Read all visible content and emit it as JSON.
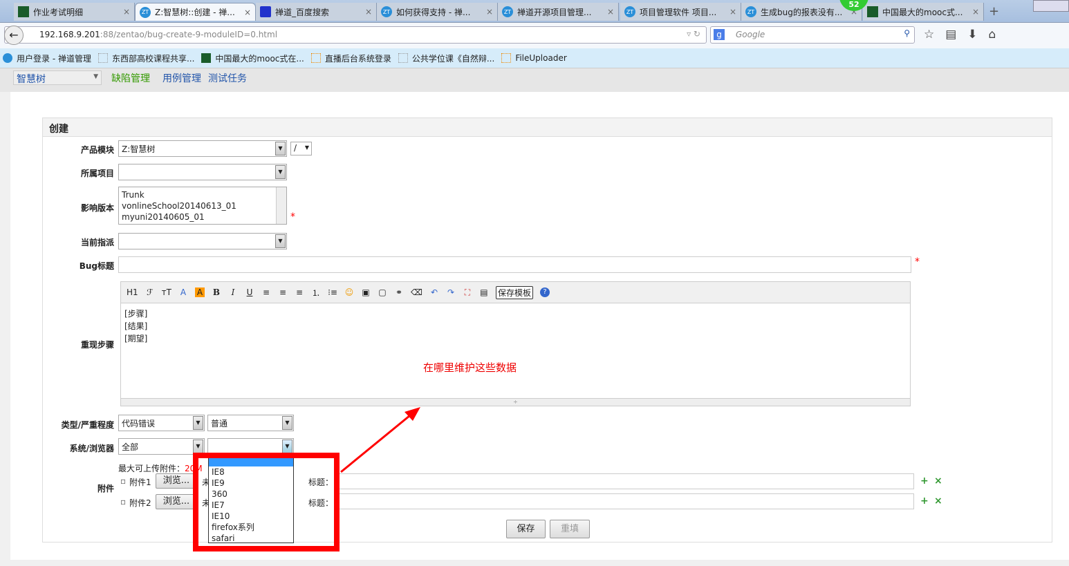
{
  "browser": {
    "tabs": [
      {
        "title": "作业考试明细",
        "active": false
      },
      {
        "title": "Z:智慧树::创建 - 禅...",
        "active": true
      },
      {
        "title": "禅道_百度搜索",
        "active": false
      },
      {
        "title": "如何获得支持 - 禅...",
        "active": false
      },
      {
        "title": "禅道开源项目管理...",
        "active": false
      },
      {
        "title": "项目管理软件 项目...",
        "active": false
      },
      {
        "title": "生成bug的报表没有...",
        "active": false
      },
      {
        "title": "中国最大的mooc式...",
        "active": false
      }
    ],
    "badge": "52",
    "url_host": "192.168.9.201",
    "url_rest": ":88/zentao/bug-create-9-moduleID=0.html",
    "search_placeholder": "Google",
    "bookmarks": [
      "用户登录 - 禅道管理",
      "东西部高校课程共享...",
      "中国最大的mooc式在...",
      "直播后台系统登录",
      "公共学位课《自然辩...",
      "FileUploader"
    ]
  },
  "app": {
    "product": "智慧树",
    "nav": [
      "缺陷管理",
      "用例管理",
      "测试任务"
    ],
    "accent": "#339900"
  },
  "form": {
    "title": "创建",
    "product_module_label": "产品模块",
    "product_value": "Z:智慧树",
    "module_value": "/",
    "project_label": "所属项目",
    "build_label": "影响版本",
    "builds": [
      "Trunk",
      "vonlineSchool20140613_01",
      "myuni20140605_01"
    ],
    "assign_label": "当前指派",
    "title_label": "Bug标题",
    "required_mark": "*",
    "steps_label": "重现步骤",
    "toolbar": {
      "h1": "H1",
      "font": "ℱ",
      "size": "тT",
      "color": "A",
      "bg": "A",
      "bold": "B",
      "italic": "I",
      "underline": "U",
      "save_template": "保存模板"
    },
    "steps_lines": [
      "[步骤]",
      "[结果]",
      "[期望]"
    ],
    "type_label": "类型/严重程度",
    "type_value": "代码错误",
    "severity_value": "普通",
    "os_label": "系统/浏览器",
    "os_value": "全部",
    "browser_value": "",
    "browser_options": [
      "",
      "IE8",
      "IE9",
      "360",
      "IE7",
      "IE10",
      "firefox系列",
      "safari"
    ],
    "max_upload_label": "最大可上传附件：",
    "max_upload_value": "20M",
    "attach_label": "附件",
    "files": [
      {
        "label": "附件1",
        "browse": "浏览...",
        "status": "未",
        "title_label": "标题："
      },
      {
        "label": "附件2",
        "browse": "浏览...",
        "status": "未",
        "title_label": "标题："
      }
    ],
    "save": "保存",
    "reset": "重填"
  },
  "annotation": "在哪里维护这些数据"
}
